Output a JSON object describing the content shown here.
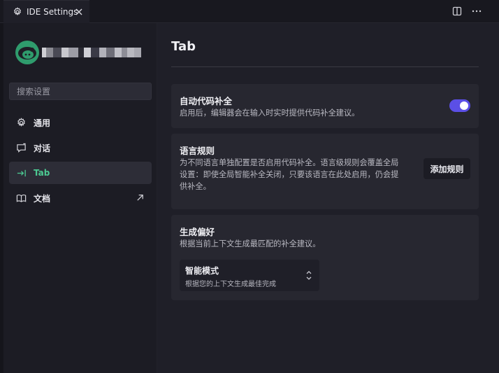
{
  "tab": {
    "title": "IDE Settings"
  },
  "sidebar": {
    "search_placeholder": "搜索设置",
    "items": [
      {
        "label": "通用",
        "icon": "gear-icon"
      },
      {
        "label": "对话",
        "icon": "chat-icon"
      },
      {
        "label": "Tab",
        "icon": "tab-arrow-icon",
        "active": true
      },
      {
        "label": "文档",
        "icon": "book-icon",
        "trailing_icon": "external-link-icon"
      }
    ]
  },
  "main": {
    "title": "Tab",
    "autocomplete": {
      "title": "自动代码补全",
      "desc": "启用后，编辑器会在输入时实时提供代码补全建议。",
      "enabled": true
    },
    "language_rules": {
      "title": "语言规则",
      "desc_lines": [
        "为不同语言单独配置是否启用代码补全。语言级规则会覆盖全局",
        "设置：即使全局智能补全关闭，只要该语言在此处启用，仍会提",
        "供补全。"
      ],
      "button": "添加规则"
    },
    "generation": {
      "title": "生成偏好",
      "desc": "根据当前上下文生成最匹配的补全建议。",
      "select_value": "智能模式",
      "select_desc": "根据您的上下文生成最佳完成"
    }
  },
  "colors": {
    "accent": "#5b4fe6",
    "active_nav": "#4cc992",
    "avatar": "#2f9c6d"
  }
}
